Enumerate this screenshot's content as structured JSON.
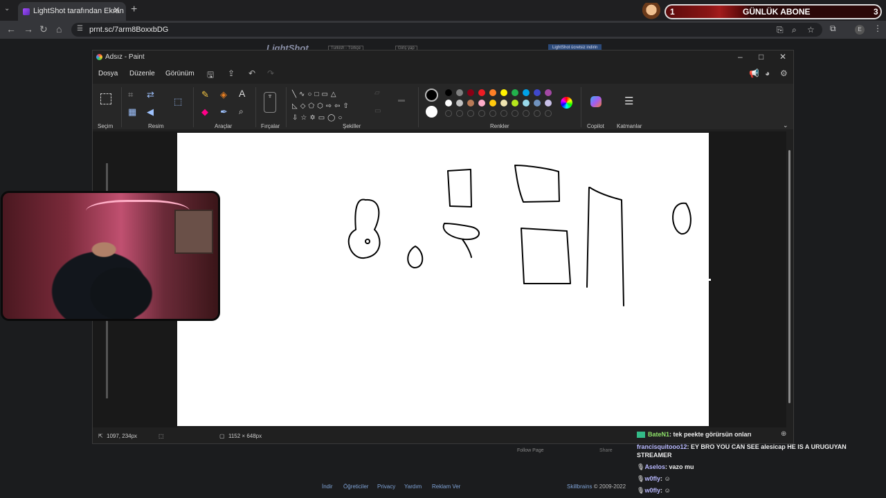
{
  "browser": {
    "tab_title": "LightShot tarafından Ekran Görüntüsü",
    "tab_title_visible": "LightShot tarafından Ekran Görü",
    "url": "prnt.sc/7arm8BoxxbDG",
    "icons": [
      "tab-list-icon",
      "close-icon",
      "new-tab-icon",
      "back-icon",
      "forward-icon",
      "reload-icon",
      "home-icon",
      "site-info-icon",
      "install-icon",
      "zoom-icon",
      "bookmark-star-icon",
      "extensions-icon",
      "profile-icon",
      "menu-icon"
    ]
  },
  "sub_widget": {
    "left_value": "1",
    "label": "GÜNLÜK ABONE",
    "right_value": "3"
  },
  "webpage": {
    "logo": "LightShot",
    "lang": "Turkish - Türkçe",
    "login": "Giriş yap",
    "download": "LightShot ücretsiz indirin",
    "follow": "Follow Page",
    "share": "Share",
    "footer_links": [
      "İndir",
      "Öğreticiler",
      "Privacy",
      "Yardım",
      "Reklam Ver"
    ],
    "footer_brand": "Skillbrains",
    "footer_copy": " © 2009-2022"
  },
  "paint": {
    "title": "Adsız - Paint",
    "menu": [
      "Dosya",
      "Düzenle",
      "Görünüm"
    ],
    "groups": {
      "selection": "Seçim",
      "image": "Resim",
      "tools": "Araçlar",
      "brushes": "Fırçalar",
      "shapes": "Şekiller",
      "colors": "Renkler",
      "copilot": "Copilot",
      "layers": "Katmanlar"
    },
    "palette_row1": [
      "#000000",
      "#7f7f7f",
      "#880015",
      "#ed1c24",
      "#ff7f27",
      "#fff200",
      "#22b14c",
      "#00a2e8",
      "#3f48cc",
      "#a349a4"
    ],
    "palette_row2": [
      "#ffffff",
      "#c3c3c3",
      "#b97a57",
      "#ffaec9",
      "#ffc90e",
      "#efe4b0",
      "#b5e61d",
      "#99d9ea",
      "#7092be",
      "#c8bfe7"
    ],
    "primary_color": "#000000",
    "secondary_color": "#ffffff",
    "status_cursor": "1097, 234px",
    "status_size": "1152 × 648px"
  },
  "chat": [
    {
      "user": "BateN1",
      "message": "tek peekte görürsün onları"
    },
    {
      "user": "francisquitooo12",
      "message": "EY BRO YOU CAN SEE alesicap HE IS A URUGUYAN STREAMER"
    },
    {
      "user": "Aselos",
      "message": "vazo mu"
    },
    {
      "user": "w0fly",
      "message": ""
    },
    {
      "user": "w0fly",
      "message": ""
    }
  ]
}
